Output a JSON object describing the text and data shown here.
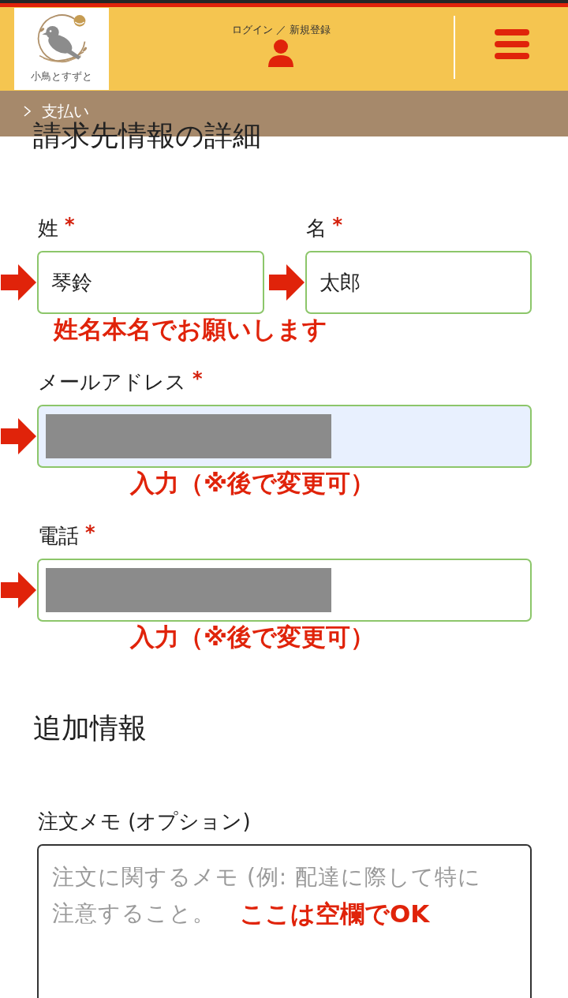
{
  "header": {
    "logo_text": "小鳥とすずと",
    "account_link": "ログイン ／ 新規登録"
  },
  "breadcrumb": {
    "current": "支払い"
  },
  "billing": {
    "title": "請求先情報の詳細",
    "rows": [
      {
        "fields": [
          {
            "label": "姓",
            "required_mark": "*",
            "value": "琴鈴",
            "redacted": false,
            "autofilled": false,
            "arrow": true
          },
          {
            "label": "名",
            "required_mark": "*",
            "value": "太郎",
            "redacted": false,
            "autofilled": false,
            "arrow": true
          }
        ],
        "note": "姓名本名でお願いします"
      },
      {
        "fields": [
          {
            "label": "メールアドレス",
            "required_mark": "*",
            "redacted": true,
            "autofilled": true,
            "arrow": true
          }
        ],
        "note": "入力（※後で変更可）"
      },
      {
        "fields": [
          {
            "label": "電話",
            "required_mark": "*",
            "redacted": true,
            "autofilled": false,
            "arrow": true
          }
        ],
        "note": "入力（※後で変更可）"
      }
    ]
  },
  "additional": {
    "title": "追加情報",
    "order_notes": {
      "label": "注文メモ (オプション)",
      "placeholder": "注文に関するメモ (例: 配達に際して特に注意すること。",
      "note": "ここは空欄でOK"
    }
  }
}
